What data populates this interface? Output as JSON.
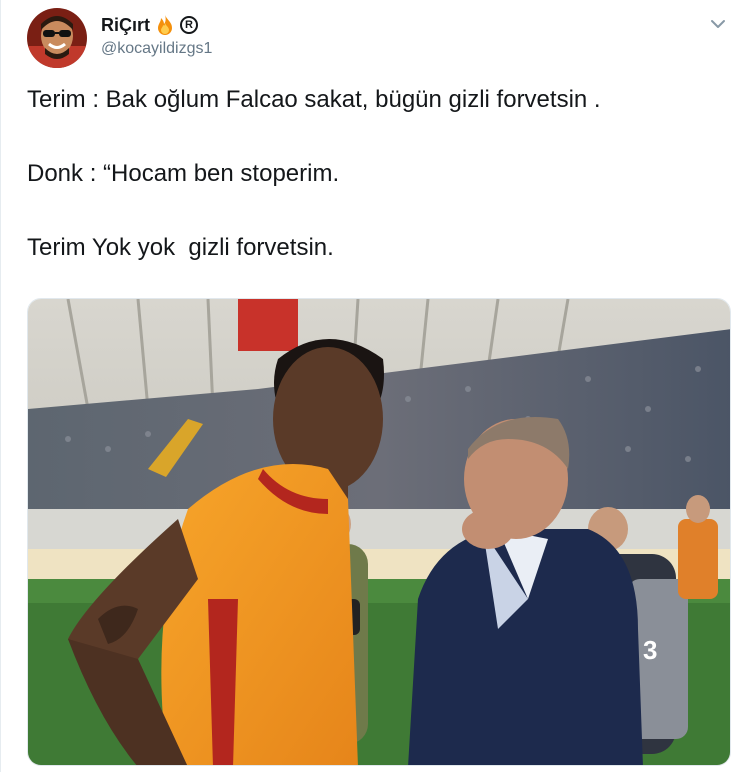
{
  "tweet": {
    "author": {
      "display_name": "RiÇırt",
      "handle": "@kocayildizgs1",
      "badges": [
        "fire-emoji",
        "registered-sign"
      ],
      "registered_symbol": "R",
      "avatar_icon": "avatar-photo"
    },
    "menu_icon": "chevron-down-icon",
    "lines": [
      "Terim : Bak oğlum Falcao sakat, bügün gizli forvetsin .",
      "Donk : “Hocam ben stoperim.",
      "Terim Yok yok  gizli forvetsin."
    ],
    "media": {
      "description_icon": "football-photo",
      "jersey_number": "3"
    }
  },
  "colors": {
    "text": "#14171a",
    "secondary_text": "#657786",
    "border": "#e6ecf0",
    "jersey_orange": "#f39a1f",
    "jersey_red": "#b3261e",
    "suit_navy": "#1d2a4d",
    "pitch_green": "#3f7a35"
  }
}
